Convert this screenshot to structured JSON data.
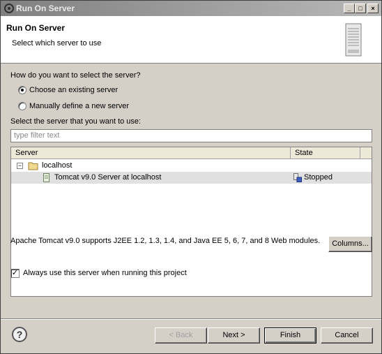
{
  "window": {
    "title": "Run On Server"
  },
  "header": {
    "title": "Run On Server",
    "description": "Select which server to use"
  },
  "selection": {
    "question": "How do you want to select the server?",
    "option_existing": "Choose an existing server",
    "option_manual": "Manually define a new server",
    "selected": "existing"
  },
  "filter": {
    "label": "Select the server that you want to use:",
    "placeholder": "type filter text",
    "value": ""
  },
  "table": {
    "columns": [
      "Server",
      "State"
    ],
    "host": "localhost",
    "server_name": "Tomcat v9.0 Server at localhost",
    "server_state": "Stopped"
  },
  "server_description": "Apache Tomcat v9.0 supports J2EE 1.2, 1.3, 1.4, and Java EE 5, 6, 7, and 8 Web modules.",
  "columns_button": "Columns...",
  "always_use": {
    "label": "Always use this server when running this project",
    "checked": true
  },
  "footer": {
    "back": "< Back",
    "next": "Next >",
    "finish": "Finish",
    "cancel": "Cancel",
    "help_glyph": "?"
  },
  "icons": [
    "app-gear-icon",
    "minimize-icon",
    "maximize-icon",
    "close-icon",
    "server-graphic-icon",
    "folder-icon",
    "server-icon",
    "server-state-icon",
    "help-icon"
  ]
}
